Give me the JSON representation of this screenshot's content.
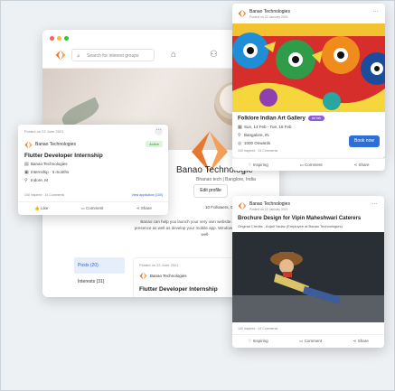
{
  "colors": {
    "accent": "#2d6fd6",
    "brand_orange": "#e8772e",
    "active_green": "#2f8f2f",
    "event_pill": "#8e5cd9"
  },
  "app": {
    "search_placeholder": "Search for interest groups",
    "icons": [
      "home-icon",
      "people-icon",
      "mail-icon"
    ]
  },
  "profile": {
    "company_name": "Banao Technologie",
    "subtitle": "Bhanao tech | Banglore, India",
    "edit_label": "Edit profile",
    "stats": "10 Followers, 01 Following",
    "description": "Banao can help you launch your very own website and bring your online presence as well as develop your mobile app. Windows within a stipulated and well-"
  },
  "left_nav": [
    "Posts (20)",
    "Interests (31)"
  ],
  "feed_post": {
    "date": "Posted on 22 June 2021",
    "company": "Banao Technologies",
    "title": "Flutter Developer Internship"
  },
  "internship_card": {
    "date": "Posted on 22 June 2021",
    "company": "Banao Technologies",
    "status": "Active",
    "title": "Flutter Developer Internship",
    "org": "Banao Technologies",
    "type": "Internship · 3 months",
    "location": "Indore, M",
    "meta": "100 Inspired · 24 Comments",
    "view_applications": "View application (100)",
    "actions": [
      "Like",
      "Comment",
      "Share"
    ]
  },
  "event_card": {
    "company": "Banao Technologies",
    "date": "Posted on 22 January 2021",
    "title": "Folklore Indian Art Gallery",
    "pill": "Art fair",
    "dates": "Sun, 14 Feb - Tue, 16 Feb",
    "location": "Bangalore, IN",
    "price": "1000 Onwards",
    "book_label": "Book now",
    "meta": "100 Inspired · 24 Comments",
    "actions": [
      "Inspiring",
      "Comment",
      "Share"
    ]
  },
  "brochure_card": {
    "company": "Banao Technologies",
    "date": "Posted on 22 January 2021",
    "title": "Brochure Design for Vipin Maheshwari Caterers",
    "subtitle": "Original Credits - Anjali Yadav (Employee at Banao Technologies)",
    "meta": "100 Inspired · 24 Comments",
    "actions": [
      "Inspiring",
      "Comment",
      "Share"
    ]
  }
}
